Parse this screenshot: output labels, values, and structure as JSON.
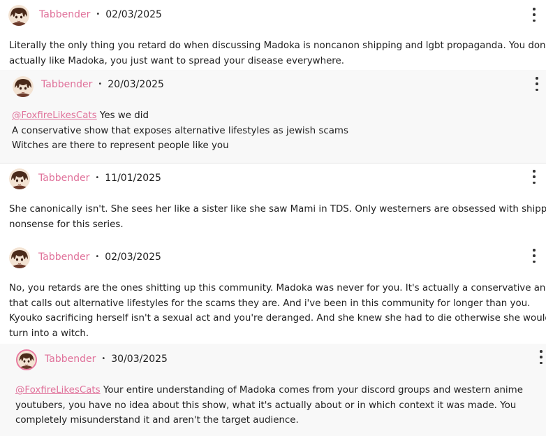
{
  "comments": [
    {
      "username": "Tabbender",
      "date": "02/03/2025",
      "lines": [
        "Literally the only thing you retard do when discussing Madoka is noncanon shipping and lgbt propaganda. You don't",
        "actually like Madoka, you just want to spread your disease everywhere."
      ]
    },
    {
      "username": "Tabbender",
      "date": "20/03/2025",
      "mention": "@FoxfireLikesCats",
      "first_line_rest": " Yes we did",
      "lines": [
        "A conservative show that exposes alternative lifestyles as jewish scams",
        "Witches are there to represent people like you"
      ]
    },
    {
      "username": "Tabbender",
      "date": "11/01/2025",
      "lines": [
        "She canonically isn't. She sees her like a sister like she saw Mami in TDS. Only westerners are obsessed with shipping",
        "nonsense for this series."
      ]
    },
    {
      "username": "Tabbender",
      "date": "02/03/2025",
      "lines": [
        "No, you retards are the ones shitting up this community. Madoka was never for you. It's actually a conservative anime",
        "that calls out alternative lifestyles for the scams they are. And i've been in this community for longer than you.",
        "Kyouko sacrificing herself isn't a sexual act and you're deranged. And she knew she had to die otherwise she would",
        "turn into a witch."
      ]
    },
    {
      "username": "Tabbender",
      "date": "30/03/2025",
      "mention": "@FoxfireLikesCats",
      "first_line_rest": " Your entire understanding of Madoka comes from your discord groups and western anime",
      "lines": [
        "youtubers, you have no idea about this show, what it's actually about or in which context it was made. You",
        "completely misunderstand it and aren't the target audience."
      ]
    }
  ],
  "separator": "•",
  "icons": {
    "avatar": "avatar-icon",
    "menu": "more-vertical-icon"
  },
  "colors": {
    "username": "#e0719a",
    "mention": "#e0719a",
    "text": "#1e1e1e",
    "reply_background": "#f8f8f8"
  }
}
